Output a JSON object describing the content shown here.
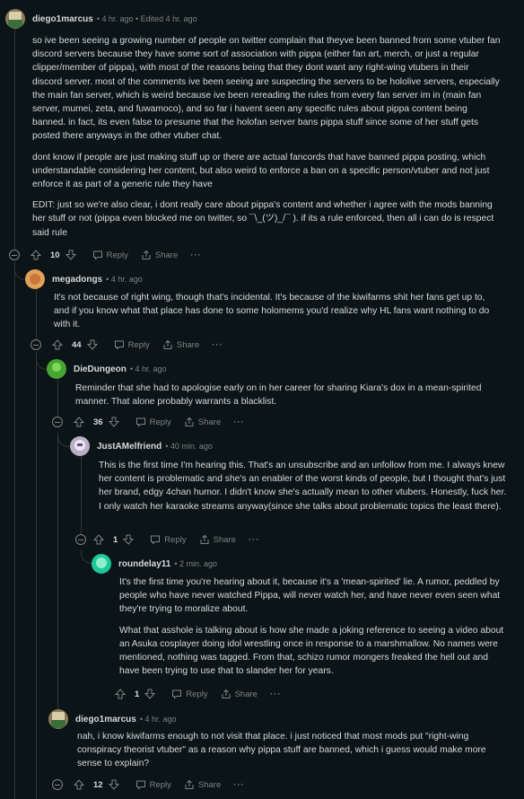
{
  "comments": [
    {
      "author": "diego1marcus",
      "meta": "• 4 hr. ago • Edited 4 hr. ago",
      "paragraphs": [
        "so ive been seeing a growing number of people on twitter complain that theyve been banned from some vtuber fan discord servers because they have some sort of association with pippa (either fan art, merch, or just a regular clipper/member of pippa), with most of the reasons being that they dont want any right-wing vtubers in their discord server. most of the comments ive been seeing are suspecting the servers to be hololive servers, especially the main fan server, which is weird because ive been rereading the rules from every fan server im in (main fan server, mumei, zeta, and fuwamoco), and so far i havent seen any specific rules about pippa content being banned. in fact, its even false to presume that the holofan server bans pippa stuff since some of her stuff gets posted there anyways in the other vtuber chat.",
        "dont know if people are just making stuff up or there are actual fancords that have banned pippa posting, which understandable considering her content, but also weird to enforce a ban on a specific person/vtuber and not just enforce it as part of a generic rule they have",
        "EDIT: just so we're also clear, i dont really care about pippa's content and whether i agree with the mods banning her stuff or not (pippa even blocked me on twitter, so ¯\\_(ツ)_/¯ ). if its a rule enforced, then all i can do is respect said rule"
      ],
      "votes": "10"
    },
    {
      "author": "megadongs",
      "meta": "• 4 hr. ago",
      "paragraphs": [
        "It's not because of right wing, though that's incidental. It's because of the kiwifarms shit her fans get up to, and if you know what that place has done to some holomems you'd realize why HL fans want nothing to do with it."
      ],
      "votes": "44"
    },
    {
      "author": "DieDungeon",
      "meta": "• 4 hr. ago",
      "paragraphs": [
        "Reminder that she had to apologise early on in her career for sharing Kiara's dox in a mean-spirited manner. That alone probably warrants a blacklist."
      ],
      "votes": "36"
    },
    {
      "author": "JustAMelfriend",
      "meta": "• 40 min. ago",
      "paragraphs": [
        "This is the first time I'm hearing this. That's an unsubscribe and an unfollow from me. I always knew her content is problematic and she's an enabler of the worst kinds of people, but I thought that's just her brand, edgy 4chan humor. I didn't know she's actually mean to other vtubers. Honestly, fuck her. I only watch her karaoke streams anyway(since she talks about problematic topics the least there)."
      ],
      "votes": "1"
    },
    {
      "author": "roundelay11",
      "meta": "• 2 min. ago",
      "paragraphs": [
        "It's the first time you're hearing about it, because it's a 'mean-spirited' lie. A rumor, peddled by people who have never watched Pippa, will never watch her, and have never even seen what they're trying to moralize about.",
        "What that asshole is talking about is how she made a joking reference to seeing a video about an Asuka cosplayer doing idol wrestling once in response to a marshmallow. No names were mentioned, nothing was tagged. From that, schizo rumor mongers freaked the hell out and have been trying to use that to slander her for years."
      ],
      "votes": "1"
    },
    {
      "author": "diego1marcus",
      "meta": "• 4 hr. ago",
      "paragraphs": [
        "nah, i know kiwifarms enough to not visit that place. i just noticed that most mods put \"right-wing conspiracy theorist vtuber\" as a reason why pippa stuff are banned, which i guess would make more sense to explain?"
      ],
      "votes": "12"
    }
  ],
  "actions": {
    "reply": "Reply",
    "share": "Share",
    "more": "···"
  }
}
